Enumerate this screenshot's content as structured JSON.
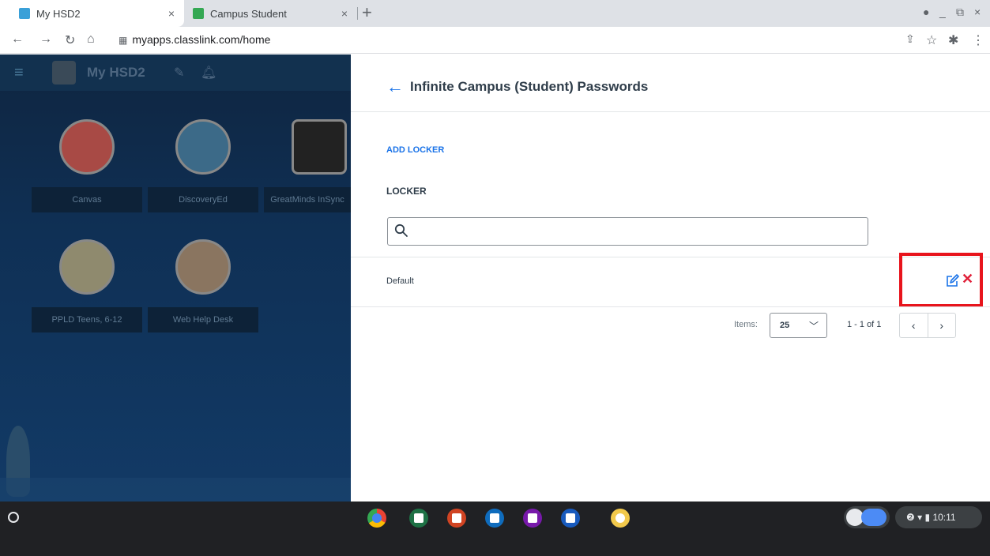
{
  "browser": {
    "tabs": [
      {
        "label": "My HSD2",
        "close": "×",
        "fav_color": "#3aa0d8"
      },
      {
        "label": "Campus Student",
        "close": "×",
        "fav_color": "#34a853"
      }
    ],
    "new_tab": "+",
    "url": "myapps.classlink.com/home",
    "window_controls": [
      "●",
      "_",
      "⧉",
      "×"
    ]
  },
  "dashboard": {
    "brand": "My HSD2",
    "apps": [
      {
        "label": "Canvas",
        "color": "#c23a2f"
      },
      {
        "label": "DiscoveryEd",
        "color": "#3d86b5"
      },
      {
        "label": "GreatMinds InSync",
        "color": "#1a1a1a"
      },
      {
        "label": "PPLD Teens, 6-12",
        "color": "#c9b67c"
      },
      {
        "label": "Web Help Desk",
        "color": "#d87a2a"
      }
    ]
  },
  "panel": {
    "title": "Infinite Campus (Student) Passwords",
    "add_locker": "ADD LOCKER",
    "locker_label": "LOCKER",
    "search_placeholder": "",
    "rows": [
      {
        "name": "Default"
      }
    ],
    "items_label": "Items:",
    "items_value": "25",
    "range": "1 - 1 of 1"
  },
  "shelf": {
    "time": "10:11",
    "apps": [
      {
        "name": "chrome-app",
        "color": "#e8453c"
      },
      {
        "name": "excel-app",
        "color": "#1e7145"
      },
      {
        "name": "powerpoint-app",
        "color": "#d04423"
      },
      {
        "name": "outlook-app",
        "color": "#0f6cbd"
      },
      {
        "name": "onenote-app",
        "color": "#7719aa"
      },
      {
        "name": "word-app",
        "color": "#185abd"
      },
      {
        "name": "classlink-app",
        "color": "#f2c94c"
      }
    ]
  }
}
